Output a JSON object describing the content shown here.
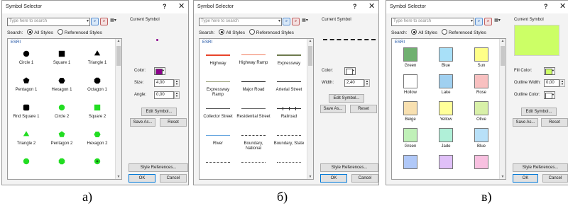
{
  "common": {
    "title": "Symbol Selector",
    "help": "?",
    "close": "✕",
    "search_placeholder": "Type here to search",
    "search_label": "Search:",
    "all_styles": "All Styles",
    "referenced_styles": "Referenced Styles",
    "group": "ESRI",
    "current_symbol": "Current Symbol",
    "edit_symbol": "Edit Symbol...",
    "save_as": "Save As...",
    "reset": "Reset",
    "style_references": "Style References...",
    "ok": "OK",
    "cancel": "Cancel"
  },
  "dialog_a": {
    "caption": "а)",
    "color_label": "Color:",
    "size_label": "Size:",
    "size_value": "4,00",
    "angle_label": "Angle:",
    "angle_value": "0,00",
    "color": "#8b008b",
    "items": [
      {
        "label": "Circle 1",
        "shape": "circle",
        "color": "#000000"
      },
      {
        "label": "Square 1",
        "shape": "square",
        "color": "#000000"
      },
      {
        "label": "Triangle 1",
        "shape": "triangle",
        "color": "#000000"
      },
      {
        "label": "Pentagon 1",
        "shape": "pentagon",
        "color": "#000000"
      },
      {
        "label": "Hexagon 1",
        "shape": "hexagon",
        "color": "#000000"
      },
      {
        "label": "Octagon 1",
        "shape": "octagon",
        "color": "#000000"
      },
      {
        "label": "Rnd Square 1",
        "shape": "rsquare",
        "color": "#000000"
      },
      {
        "label": "Circle 2",
        "shape": "circle",
        "color": "#22dd22"
      },
      {
        "label": "Square 2",
        "shape": "square",
        "color": "#22dd22"
      },
      {
        "label": "Triangle 2",
        "shape": "triangle",
        "color": "#22dd22"
      },
      {
        "label": "Pentagon 2",
        "shape": "pentagon",
        "color": "#22dd22"
      },
      {
        "label": "Hexagon 2",
        "shape": "hexagon",
        "color": "#22dd22"
      },
      {
        "label": "",
        "shape": "circle",
        "color": "#22dd22"
      },
      {
        "label": "",
        "shape": "octagon",
        "color": "#22dd22"
      },
      {
        "label": "",
        "shape": "circle-dot",
        "color": "#22dd22"
      }
    ]
  },
  "dialog_b": {
    "caption": "б)",
    "color_label": "Color:",
    "width_label": "Width:",
    "width_value": "2,40",
    "items": [
      {
        "label": "Highway",
        "color": "#e8442a",
        "thick": 2,
        "style": "solid"
      },
      {
        "label": "Highway Ramp",
        "color": "#f07a5a",
        "thick": 1.5,
        "style": "solid"
      },
      {
        "label": "Expressway",
        "color": "#6e7a4e",
        "thick": 2,
        "style": "solid"
      },
      {
        "label": "Expressway Ramp",
        "color": "#9aa07a",
        "thick": 1.5,
        "style": "solid"
      },
      {
        "label": "Major Road",
        "color": "#222222",
        "thick": 1.5,
        "style": "solid"
      },
      {
        "label": "Arterial Street",
        "color": "#333333",
        "thick": 1,
        "style": "solid"
      },
      {
        "label": "Collector Street",
        "color": "#555555",
        "thick": 0.8,
        "style": "solid"
      },
      {
        "label": "Residential Street",
        "color": "#666666",
        "thick": 0.6,
        "style": "solid"
      },
      {
        "label": "Railroad",
        "color": "#333333",
        "thick": 1,
        "style": "rail"
      },
      {
        "label": "River",
        "color": "#6aa8e0",
        "thick": 1,
        "style": "solid"
      },
      {
        "label": "Boundary, National",
        "color": "#444444",
        "thick": 1.5,
        "style": "dash"
      },
      {
        "label": "Boundary, State",
        "color": "#555555",
        "thick": 1.2,
        "style": "dash"
      },
      {
        "label": "",
        "color": "#555555",
        "thick": 1,
        "style": "dash"
      },
      {
        "label": "",
        "color": "#555555",
        "thick": 1,
        "style": "dot"
      },
      {
        "label": "",
        "color": "#555555",
        "thick": 1,
        "style": "dot"
      }
    ]
  },
  "dialog_c": {
    "caption": "в)",
    "fill_color_label": "Fill Color:",
    "outline_width_label": "Outline Width:",
    "outline_width_value": "0,00",
    "outline_color_label": "Outline Color:",
    "preview_color": "#ccff66",
    "items": [
      {
        "label": "Green",
        "color": "#70b070"
      },
      {
        "label": "Blue",
        "color": "#a8e0f8"
      },
      {
        "label": "Sun",
        "color": "#ffff88"
      },
      {
        "label": "Hollow",
        "color": "#ffffff"
      },
      {
        "label": "Lake",
        "color": "#a0d0f0"
      },
      {
        "label": "Rose",
        "color": "#f8c0c0"
      },
      {
        "label": "Beige",
        "color": "#f8e0b0"
      },
      {
        "label": "Yellow",
        "color": "#ffff99"
      },
      {
        "label": "Olive",
        "color": "#d8f0a8"
      },
      {
        "label": "Green",
        "color": "#c0f0b8"
      },
      {
        "label": "Jade",
        "color": "#b0f0d8"
      },
      {
        "label": "Blue",
        "color": "#b8e0f8"
      },
      {
        "label": "",
        "color": "#b0c8f8"
      },
      {
        "label": "",
        "color": "#e0c0f8"
      },
      {
        "label": "",
        "color": "#f8c0e0"
      }
    ]
  }
}
